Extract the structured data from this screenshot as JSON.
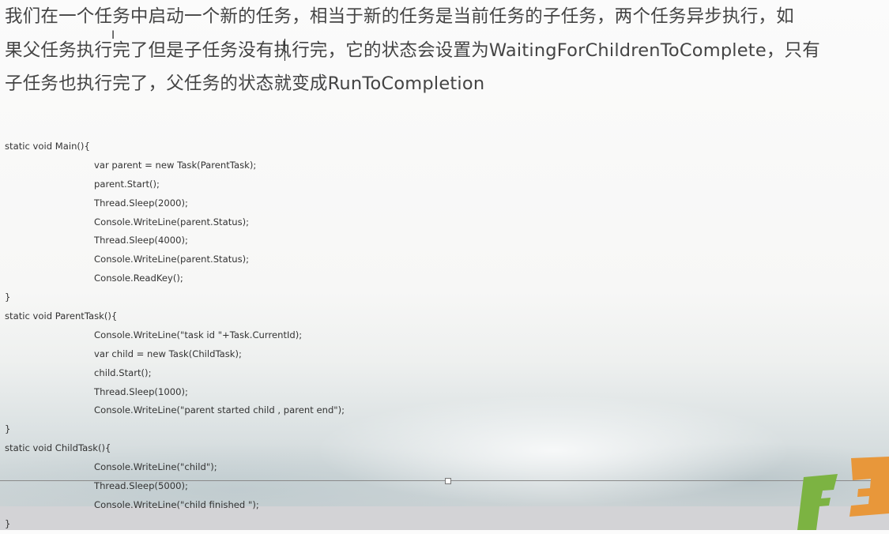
{
  "heading": {
    "lines": [
      "我们在一个任务中启动一个新的任务，相当于新的任务是当前任务的子任务，两个任务异步执行，如",
      "果父任务执行完了但是子任务没有执行完，它的状态会设置为WaitingForChildrenToComplete，只有",
      "子任务也执行完了，父任务的状态就变成RunToCompletion"
    ]
  },
  "code": [
    {
      "text": "static void Main(){",
      "indent": 0
    },
    {
      "text": "var parent = new Task(ParentTask);",
      "indent": 1
    },
    {
      "text": "parent.Start();",
      "indent": 1
    },
    {
      "text": "Thread.Sleep(2000);",
      "indent": 1
    },
    {
      "text": "Console.WriteLine(parent.Status);",
      "indent": 1
    },
    {
      "text": "Thread.Sleep(4000);",
      "indent": 1
    },
    {
      "text": "Console.WriteLine(parent.Status);",
      "indent": 1
    },
    {
      "text": "Console.ReadKey();",
      "indent": 1
    },
    {
      "text": "}",
      "indent": 0
    },
    {
      "text": "static void ParentTask(){",
      "indent": 0
    },
    {
      "text": "Console.WriteLine(\"task id \"+Task.CurrentId);",
      "indent": 1
    },
    {
      "text": "var child = new Task(ChildTask);",
      "indent": 1
    },
    {
      "text": "child.Start();",
      "indent": 1
    },
    {
      "text": "Thread.Sleep(1000);",
      "indent": 1
    },
    {
      "text": "Console.WriteLine(\"parent started child , parent end\");",
      "indent": 1
    },
    {
      "text": "}",
      "indent": 0
    },
    {
      "text": "static void ChildTask(){",
      "indent": 0
    },
    {
      "text": "Console.WriteLine(\"child\");",
      "indent": 1
    },
    {
      "text": "Thread.Sleep(5000);",
      "indent": 1
    },
    {
      "text": "Console.WriteLine(\"child finished \");",
      "indent": 1
    },
    {
      "text": "}",
      "indent": 0
    }
  ],
  "colors": {
    "logo_green": "#7cb342",
    "logo_orange": "#e8973a"
  }
}
